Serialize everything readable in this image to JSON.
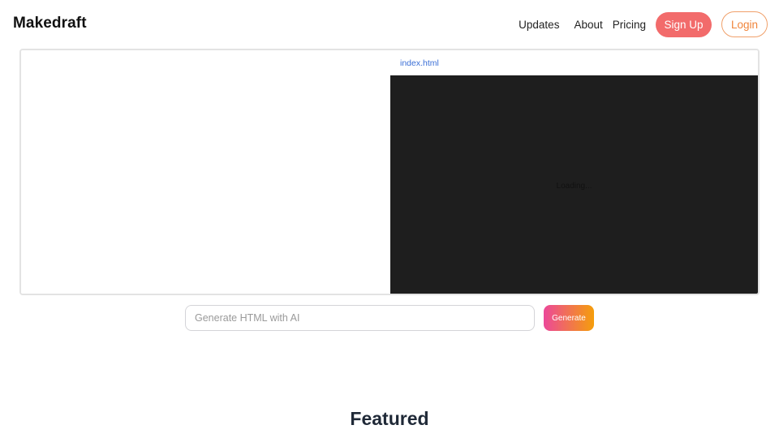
{
  "header": {
    "logo": "Makedraft",
    "nav": {
      "updates": "Updates",
      "about": "About",
      "pricing": "Pricing"
    },
    "signup_label": "Sign Up",
    "login_label": "Login"
  },
  "editor": {
    "file_tab": "index.html",
    "preview_status": "Loading..."
  },
  "generator": {
    "placeholder": "Generate HTML with AI",
    "value": "",
    "button_label": "Generate"
  },
  "featured": {
    "heading": "Featured"
  },
  "colors": {
    "signup_bg": "#f26b6b",
    "login_accent": "#f0843a",
    "file_tab_link": "#3b6fd6",
    "preview_bg": "#1e1e1e",
    "generate_gradient_start": "#ec4899",
    "generate_gradient_end": "#f59e0b"
  }
}
